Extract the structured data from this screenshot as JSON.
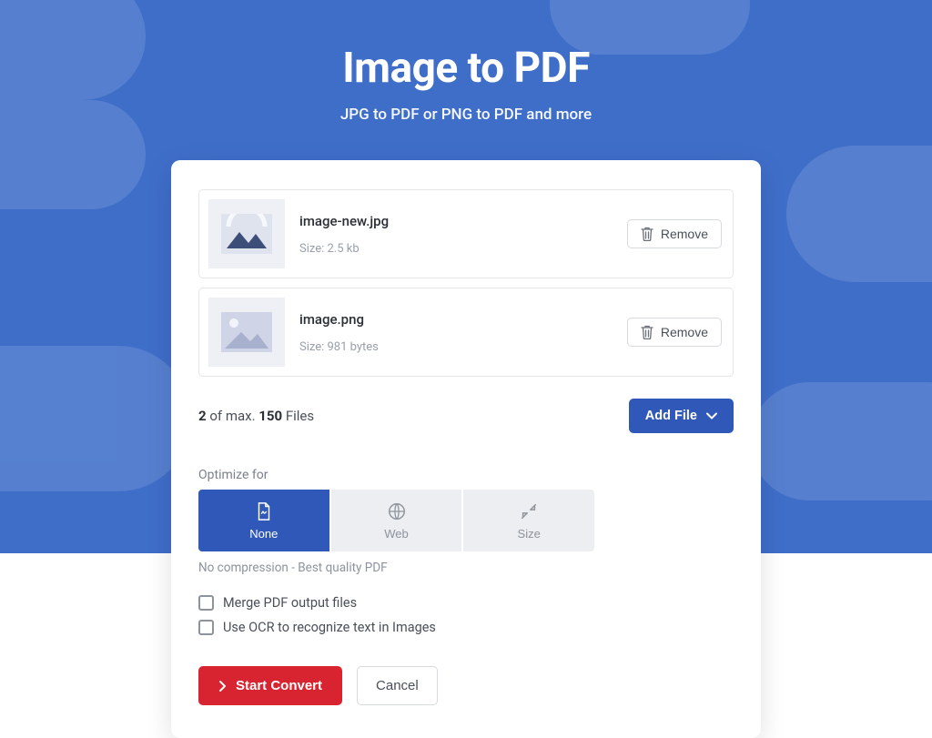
{
  "header": {
    "title": "Image to PDF",
    "subtitle": "JPG to PDF or PNG to PDF and more"
  },
  "files": [
    {
      "name": "image-new.jpg",
      "size_label": "Size: 2.5 kb",
      "remove_label": "Remove"
    },
    {
      "name": "image.png",
      "size_label": "Size: 981 bytes",
      "remove_label": "Remove"
    }
  ],
  "files_footer": {
    "count_current": "2",
    "count_separator": " of max. ",
    "count_max": "150",
    "count_suffix": " Files",
    "add_file_label": "Add File"
  },
  "optimize": {
    "section_label": "Optimize for",
    "hint": "No compression - Best quality PDF",
    "options": [
      {
        "label": "None",
        "active": true
      },
      {
        "label": "Web",
        "active": false
      },
      {
        "label": "Size",
        "active": false
      }
    ]
  },
  "checkboxes": {
    "merge": "Merge PDF output files",
    "ocr": "Use OCR to recognize text in Images"
  },
  "actions": {
    "start": "Start Convert",
    "cancel": "Cancel"
  }
}
